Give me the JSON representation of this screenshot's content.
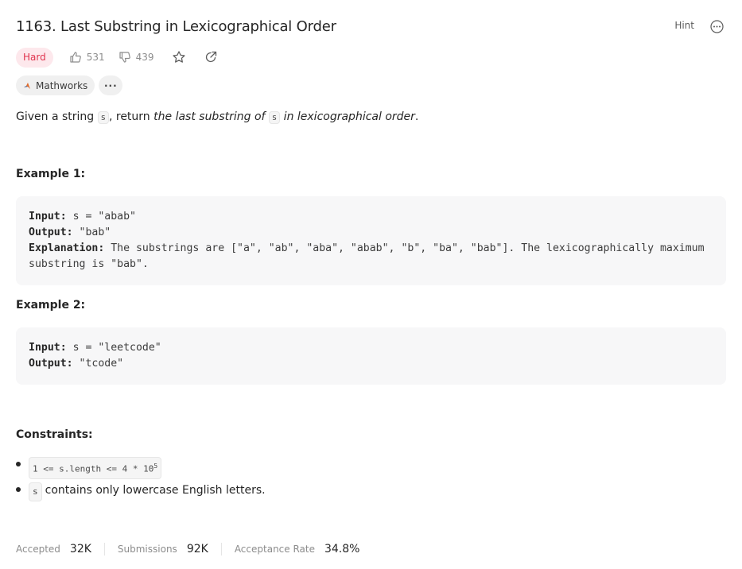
{
  "problem": {
    "title": "1163. Last Substring in Lexicographical Order",
    "hint_label": "Hint",
    "difficulty": "Hard",
    "likes": "531",
    "dislikes": "439",
    "tags": [
      "Mathworks"
    ],
    "more_tags_label": "···"
  },
  "description": {
    "p1": "Given a string ",
    "code_s": "s",
    "p2": ", return ",
    "em1": "the last substring of ",
    "em2": " in lexicographical order",
    "p3": "."
  },
  "examples": [
    {
      "heading": "Example 1:",
      "input_label": "Input:",
      "input_value": " s = \"abab\"",
      "output_label": "Output:",
      "output_value": " \"bab\"",
      "explanation_label": "Explanation:",
      "explanation_value": " The substrings are [\"a\", \"ab\", \"aba\", \"abab\", \"b\", \"ba\", \"bab\"]. The lexicographically maximum substring is \"bab\"."
    },
    {
      "heading": "Example 2:",
      "input_label": "Input:",
      "input_value": " s = \"leetcode\"",
      "output_label": "Output:",
      "output_value": " \"tcode\""
    }
  ],
  "constraints": {
    "heading": "Constraints:",
    "c1_code": "1 <= s.length <= 4 * 10",
    "c1_sup": "5",
    "c2_code": "s",
    "c2_text": "contains only lowercase English letters."
  },
  "stats": {
    "accepted_label": "Accepted",
    "accepted_value": "32K",
    "submissions_label": "Submissions",
    "submissions_value": "92K",
    "rate_label": "Acceptance Rate",
    "rate_value": "34.8%"
  },
  "colors": {
    "hard": "#e0334d",
    "hard_bg": "#fde8ec",
    "code_bg": "#f7f7f8"
  }
}
